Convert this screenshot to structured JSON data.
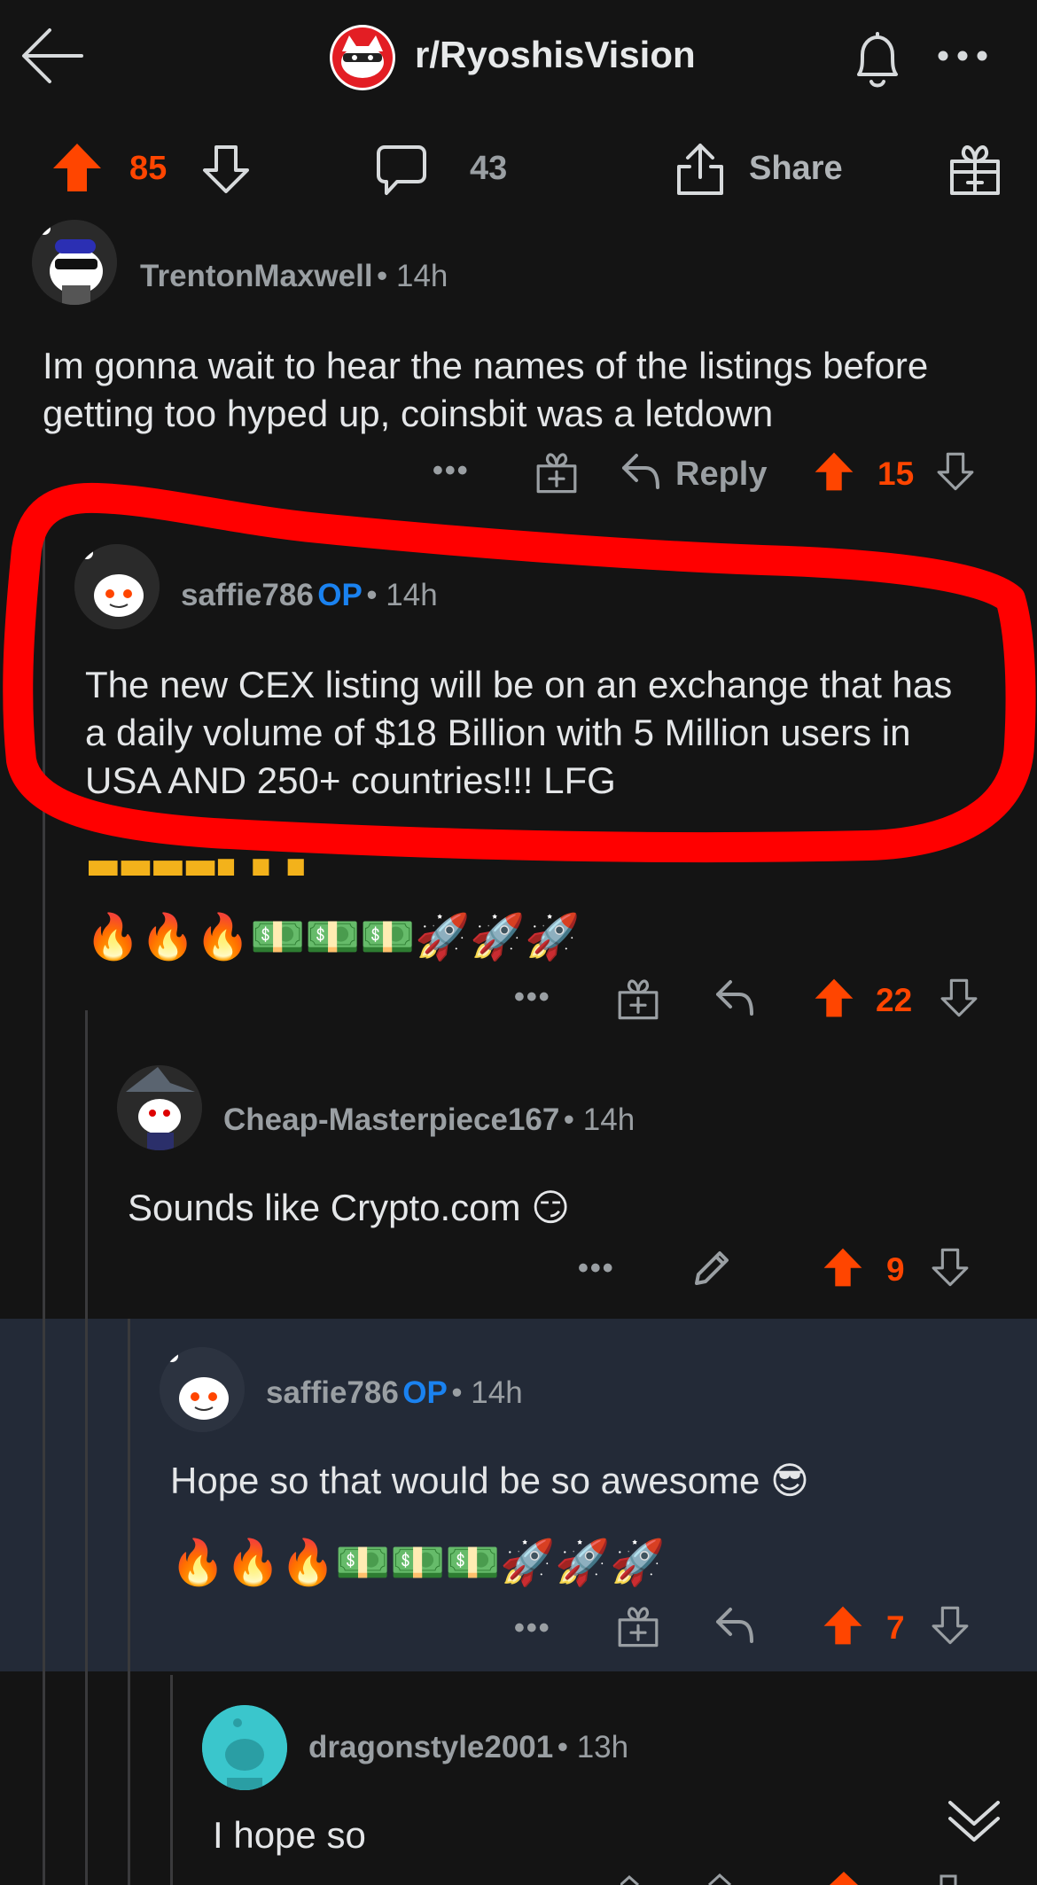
{
  "header": {
    "subreddit": "r/RyoshisVision"
  },
  "post_actions": {
    "score": "85",
    "comment_count": "43",
    "share_label": "Share"
  },
  "comments": [
    {
      "username": "TrentonMaxwell",
      "time": "14h",
      "body": "Im gonna wait to hear the names of the listings before getting too hyped up, coinsbit was a letdown",
      "reply_label": "Reply",
      "score": "15"
    },
    {
      "username": "saffie786",
      "op": "OP",
      "time": "14h",
      "body": "The new CEX listing will be on an exchange that has a daily volume of $18 Billion with 5 Million users in USA AND 250+ countries!!! LFG",
      "emojis": "🔥🔥🔥💵💵💵🚀🚀🚀",
      "score": "22"
    },
    {
      "username": "Cheap-Masterpiece167",
      "time": "14h",
      "body": "Sounds like Crypto.com 😏",
      "score": "9"
    },
    {
      "username": "saffie786",
      "op": "OP",
      "time": "14h",
      "body": "Hope so that would be so awesome 😎",
      "emojis": "🔥🔥🔥💵💵💵🚀🚀🚀",
      "score": "7"
    },
    {
      "username": "dragonstyle2001",
      "time": "13h",
      "body": "I hope so"
    }
  ],
  "colors": {
    "upvote": "#ff4500",
    "op_badge": "#1a82f0",
    "highlight_bg": "#232a37",
    "annotation_red": "#ff0000"
  }
}
